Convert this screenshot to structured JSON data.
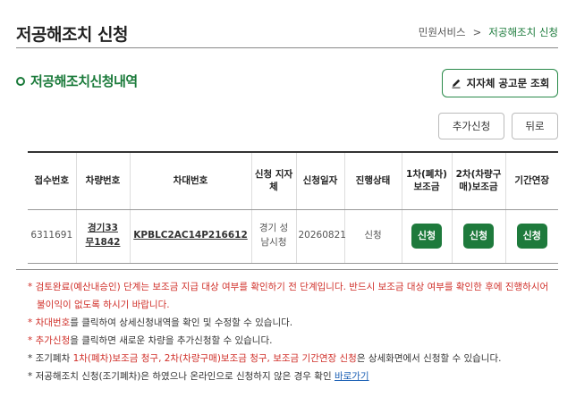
{
  "header": {
    "title": "저공해조치 신청",
    "breadcrumb": [
      "민원서비스",
      ">",
      "저공해조치 신청"
    ]
  },
  "section": {
    "title": "저공해조치신청내역",
    "notice_button": "지자체 공고문 조회"
  },
  "toolbar": {
    "add_label": "추가신청",
    "back_label": "뒤로"
  },
  "table": {
    "headers": [
      "접수번호",
      "차량번호",
      "차대번호",
      "신청 지자체",
      "신청일자",
      "진행상태",
      "1차(폐차)보조금",
      "2차(차량구매)보조금",
      "기간연장"
    ],
    "rows": [
      {
        "receipt_no": "6311691",
        "plate_line1": "경기33",
        "plate_line2": "무1842",
        "vin": "KPBLC2AC14P216612",
        "region_line1": "경기 성",
        "region_line2": "남시청",
        "date": "20260821",
        "status": "신청",
        "btn1": "신청",
        "btn2": "신청",
        "btn3": "신청"
      }
    ]
  },
  "notes": {
    "n1_star": "* ",
    "n1_text": "검토완료(예산내승인) 단계는 보조금 지급 대상 여부를 확인하기 전 단계입니다. 반드시 보조금 대상 여부를 확인한 후에 진행하시어",
    "n1_cont": "불이익이 없도록 하시기 바랍니다.",
    "n2_star": "* ",
    "n2_key": "차대번호",
    "n2_text": "를 클릭하여 상세신청내역을 확인 및 수정할 수 있습니다.",
    "n3_star": "* ",
    "n3_key": "추가신청",
    "n3_text": "을 클릭하면 새로운 차량을 추가신청할 수 있습니다.",
    "n4_prefix": "* 조기폐차 ",
    "n4_key": "1차(폐차)보조금 청구, 2차(차량구매)보조금 청구, 보조금 기간연장 신청",
    "n4_text": "은 상세화면에서 신청할 수 있습니다.",
    "n5_text": "* 저공해조치 신청(조기폐차)은 하였으나 온라인으로 신청하지 않은 경우 확인 ",
    "n5_link": "바로가기"
  },
  "colors": {
    "accent_green": "#1a7a3a",
    "button_green": "#1e7a3c",
    "warning_red": "#d0302a"
  }
}
